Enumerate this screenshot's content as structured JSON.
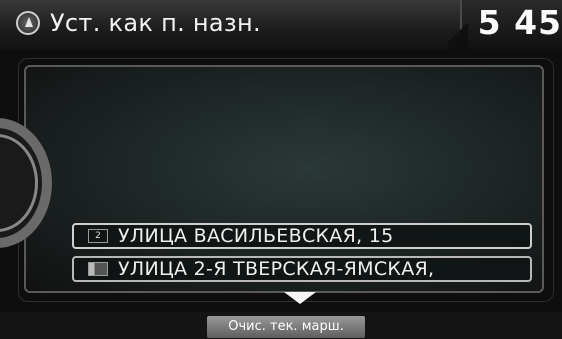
{
  "header": {
    "title": "Уст. как п. назн.",
    "clock": "5 45",
    "icon": "navigation-compass-icon"
  },
  "destinations": [
    {
      "icon_label": "2",
      "icon": "waypoint-number-icon",
      "text": "УЛИЦА ВАСИЛЬЕВСКАЯ, 15"
    },
    {
      "icon": "destination-flag-icon",
      "text": "УЛИЦА 2-Я ТВЕРСКАЯ-ЯМСКАЯ,"
    }
  ],
  "footer": {
    "clear_route_label": "Очис. тек. марш."
  },
  "colors": {
    "background": "#0e0e0e",
    "text": "#f0f0f0",
    "accent": "#cfcfcf"
  }
}
